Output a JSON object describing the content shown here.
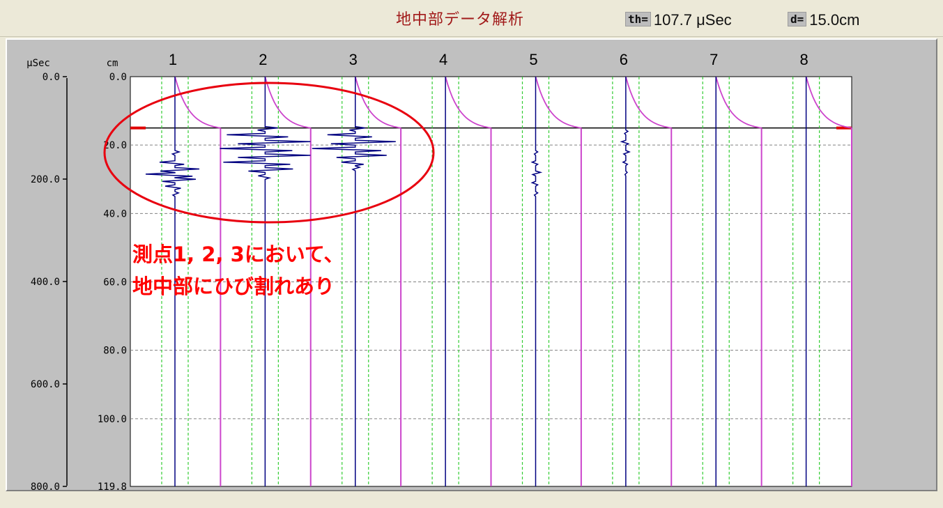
{
  "header": {
    "title": "地中部データ解析",
    "th_label": "th=",
    "th_value": "107.7",
    "th_unit": "μSec",
    "d_label": "d=",
    "d_value": "15.0cm"
  },
  "annotation": {
    "line1": "測点1, 2, 3において、",
    "line2": "地中部にひび割れあり"
  },
  "chart_data": {
    "type": "line",
    "time_axis": {
      "unit_label": "μSec",
      "ticks": [
        "0.0",
        "200.0",
        "400.0",
        "600.0",
        "800.0"
      ],
      "range": [
        0,
        800
      ]
    },
    "depth_axis": {
      "unit_label": "cm",
      "ticks": [
        "0.0",
        "20.0",
        "40.0",
        "60.0",
        "80.0",
        "100.0",
        "119.8"
      ],
      "range": [
        0,
        119.8
      ]
    },
    "stations": [
      "1",
      "2",
      "3",
      "4",
      "5",
      "6",
      "7",
      "8"
    ],
    "reference_depth": 15.0,
    "grid": true,
    "series": [
      {
        "station": "1",
        "reflections": [
          {
            "depth": 22,
            "amp": 6
          },
          {
            "depth": 25,
            "amp": 22
          },
          {
            "depth": 27,
            "amp": 35
          },
          {
            "depth": 28.5,
            "amp": 42
          },
          {
            "depth": 30,
            "amp": 30
          },
          {
            "depth": 32,
            "amp": 14
          },
          {
            "depth": 34,
            "amp": 5
          }
        ]
      },
      {
        "station": "2",
        "reflections": [
          {
            "depth": 15,
            "amp": 18
          },
          {
            "depth": 17,
            "amp": 55
          },
          {
            "depth": 19,
            "amp": 65
          },
          {
            "depth": 21,
            "amp": 65
          },
          {
            "depth": 23,
            "amp": 65
          },
          {
            "depth": 25,
            "amp": 60
          },
          {
            "depth": 27,
            "amp": 40
          },
          {
            "depth": 29,
            "amp": 10
          }
        ]
      },
      {
        "station": "3",
        "reflections": [
          {
            "depth": 15,
            "amp": 14
          },
          {
            "depth": 17,
            "amp": 40
          },
          {
            "depth": 19,
            "amp": 58
          },
          {
            "depth": 21,
            "amp": 62
          },
          {
            "depth": 23,
            "amp": 45
          },
          {
            "depth": 25,
            "amp": 20
          },
          {
            "depth": 26.5,
            "amp": 6
          }
        ]
      },
      {
        "station": "4",
        "reflections": []
      },
      {
        "station": "5",
        "reflections": [
          {
            "depth": 22,
            "amp": 3
          },
          {
            "depth": 25,
            "amp": 5
          },
          {
            "depth": 28,
            "amp": 7
          },
          {
            "depth": 31,
            "amp": 5
          },
          {
            "depth": 34,
            "amp": 3
          }
        ]
      },
      {
        "station": "6",
        "reflections": [
          {
            "depth": 16,
            "amp": 3
          },
          {
            "depth": 19,
            "amp": 6
          },
          {
            "depth": 22,
            "amp": 5
          },
          {
            "depth": 25,
            "amp": 4
          },
          {
            "depth": 28,
            "amp": 2
          }
        ]
      },
      {
        "station": "7",
        "reflections": []
      },
      {
        "station": "8",
        "reflections": []
      }
    ]
  }
}
